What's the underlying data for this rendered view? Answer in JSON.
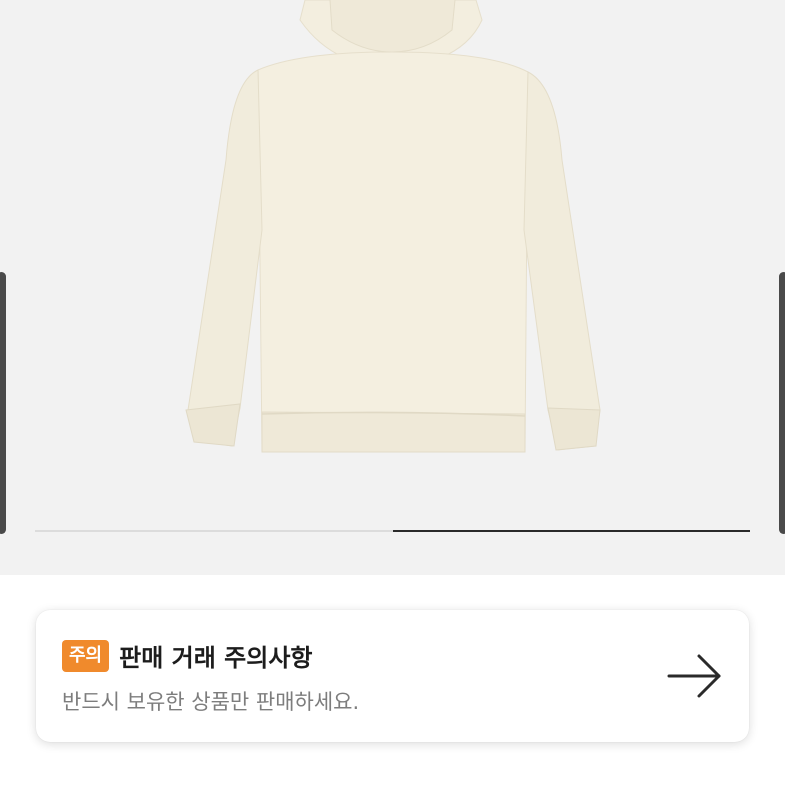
{
  "gallery": {
    "image_alt": "cream hoodie back view",
    "progress": {
      "start": 0.5,
      "end": 1.0
    }
  },
  "notice": {
    "badge": "주의",
    "title": "판매 거래 주의사항",
    "description": "반드시 보유한 상품만 판매하세요.",
    "arrow_icon": "arrow-right-icon",
    "badge_color": "#f08a2c"
  }
}
